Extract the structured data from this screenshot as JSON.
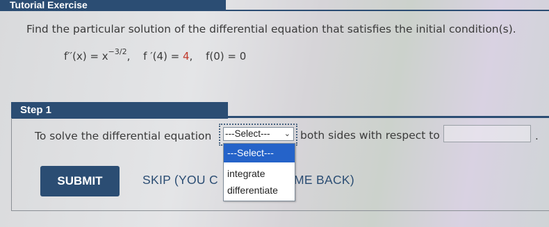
{
  "header": {
    "title": "Tutorial Exercise"
  },
  "question": {
    "prompt": "Find the particular solution of the differential equation that satisfies the initial condition(s).",
    "eq_lhs": "f′′(x) = x",
    "eq_exp": "−3/2",
    "eq_cond1_lhs": "f ′(4) = ",
    "eq_cond1_val": "4",
    "eq_cond2": "f(0) = 0"
  },
  "step": {
    "label": "Step 1",
    "text_before": "To solve the differential equation",
    "text_after": "both sides with respect to",
    "answer_value": "",
    "period": "."
  },
  "select": {
    "selected": "---Select---",
    "options": [
      "---Select---",
      "integrate",
      "differentiate"
    ]
  },
  "actions": {
    "submit_label": "SUBMIT",
    "skip_label_visible": "SKIP (YOU C",
    "skip_label_tail": "ME BACK)"
  },
  "colors": {
    "brand": "#2b4d73",
    "highlight": "#c0392b",
    "option_selected_bg": "#2563c9"
  }
}
